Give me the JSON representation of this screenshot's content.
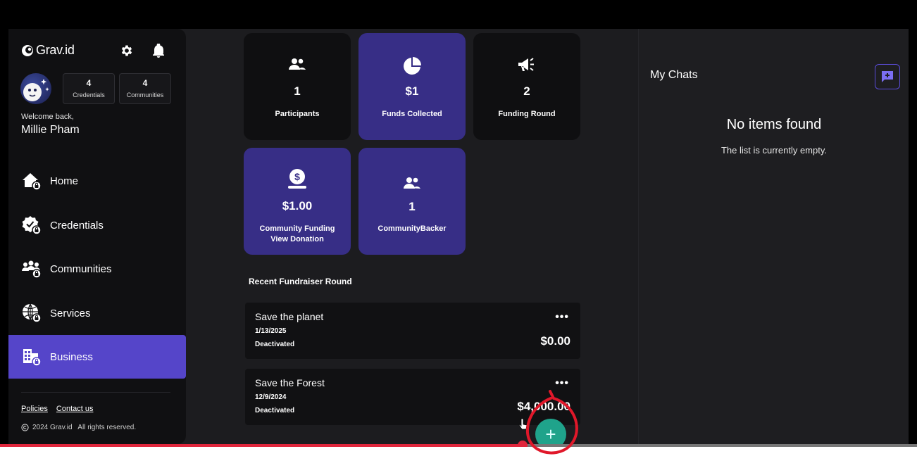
{
  "app": {
    "logo_text": "Grav.id"
  },
  "user": {
    "welcome": "Welcome back,",
    "name": "Millie Pham",
    "stats": [
      {
        "value": "4",
        "label": "Credentials"
      },
      {
        "value": "4",
        "label": "Communities"
      }
    ]
  },
  "nav": [
    {
      "label": "Home",
      "icon": "home-icon",
      "active": false
    },
    {
      "label": "Credentials",
      "icon": "credentials-icon",
      "active": false
    },
    {
      "label": "Communities",
      "icon": "communities-icon",
      "active": false
    },
    {
      "label": "Services",
      "icon": "services-icon",
      "active": false
    },
    {
      "label": "Business",
      "icon": "business-icon",
      "active": true
    }
  ],
  "footer": {
    "policies": "Policies",
    "contact": "Contact us",
    "copyright": "2024 Grav.id   All rights reserved."
  },
  "cards": [
    {
      "value": "1",
      "label": "Participants",
      "icon": "people-icon",
      "style": "dark"
    },
    {
      "value": "$1",
      "label": "Funds Collected",
      "icon": "pie-chart-icon",
      "style": "purple"
    },
    {
      "value": "2",
      "label": "Funding Round",
      "icon": "megaphone-icon",
      "style": "dark"
    },
    {
      "value": "$1.00",
      "label": "Community Funding",
      "label2": "View Donation",
      "icon": "money-bag-icon",
      "style": "purple"
    },
    {
      "value": "1",
      "label": "CommunityBacker",
      "icon": "people-icon",
      "style": "purple"
    }
  ],
  "recent": {
    "title": "Recent Fundraiser Round",
    "rounds": [
      {
        "title": "Save the planet",
        "date": "1/13/2025",
        "status": "Deactivated",
        "amount": "$0.00"
      },
      {
        "title": "Save the Forest",
        "date": "12/9/2024",
        "status": "Deactivated",
        "amount": "$4,000.00"
      }
    ],
    "add_label": "+"
  },
  "chats": {
    "title": "My Chats",
    "empty_title": "No items found",
    "empty_sub": "The list is currently empty."
  },
  "video": {
    "progress": 0.57
  },
  "colors": {
    "accent": "#5545c9",
    "card_purple": "#372e86",
    "fab": "#1fa38b",
    "progress": "#e0263c",
    "annotation": "#e0182a"
  }
}
